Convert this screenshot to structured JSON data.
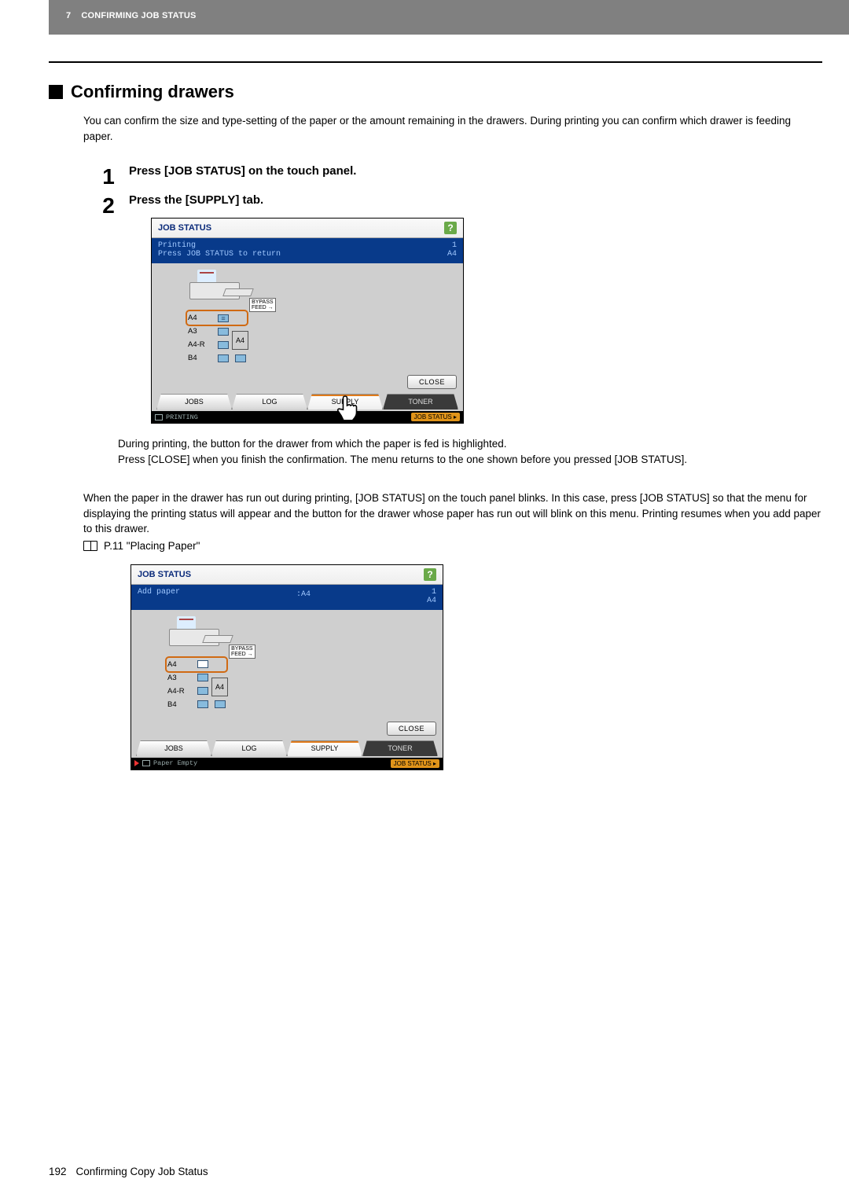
{
  "header": {
    "chapter_prefix": "7",
    "chapter_title": "CONFIRMING JOB STATUS"
  },
  "h2": "Confirming drawers",
  "intro": "You can confirm the size and type-setting of the paper or the amount remaining in the drawers. During printing you can confirm which drawer is feeding paper.",
  "steps": {
    "s1": {
      "num": "1",
      "title": "Press [JOB STATUS] on the touch panel."
    },
    "s2": {
      "num": "2",
      "title": "Press the [SUPPLY] tab."
    }
  },
  "followup": "During printing, the button for the drawer from which the paper is fed is highlighted.\nPress [CLOSE] when you finish the confirmation. The menu returns to the one shown before you pressed [JOB STATUS].",
  "runout": "When the paper in the drawer has run out during printing, [JOB STATUS] on the touch panel blinks. In this case, press [JOB STATUS] so that the menu for displaying the printing status will appear and the button for the drawer whose paper has run out will blink on this menu. Printing resumes when you add paper to this drawer.",
  "ref": "P.11 \"Placing Paper\"",
  "panel1": {
    "title": "JOB STATUS",
    "status_line1": "Printing",
    "status_line2": "Press JOB STATUS to return",
    "status_right_top": "1",
    "status_right_bottom": "A4",
    "bypass": "BYPASS\nFEED →",
    "drawers": {
      "d1": "A4",
      "d2": "A3",
      "d3": "A4-R",
      "d4": "B4",
      "side": "A4"
    },
    "close": "CLOSE",
    "tabs": {
      "jobs": "JOBS",
      "log": "LOG",
      "supply": "SUPPLY",
      "toner": "TONER"
    },
    "footer_left": "PRINTING",
    "footer_badge": "JOB STATUS ▸"
  },
  "panel2": {
    "title": "JOB STATUS",
    "status_line1": "Add paper",
    "status_center": ":A4",
    "status_right_top": "1",
    "status_right_bottom": "A4",
    "bypass": "BYPASS\nFEED →",
    "drawers": {
      "d1": "A4",
      "d2": "A3",
      "d3": "A4-R",
      "d4": "B4",
      "side": "A4"
    },
    "close": "CLOSE",
    "tabs": {
      "jobs": "JOBS",
      "log": "LOG",
      "supply": "SUPPLY",
      "toner": "TONER"
    },
    "footer_left": "Paper Empty",
    "footer_badge": "JOB STATUS ▸"
  },
  "page_footer": {
    "page_number": "192",
    "section": "Confirming Copy Job Status"
  }
}
